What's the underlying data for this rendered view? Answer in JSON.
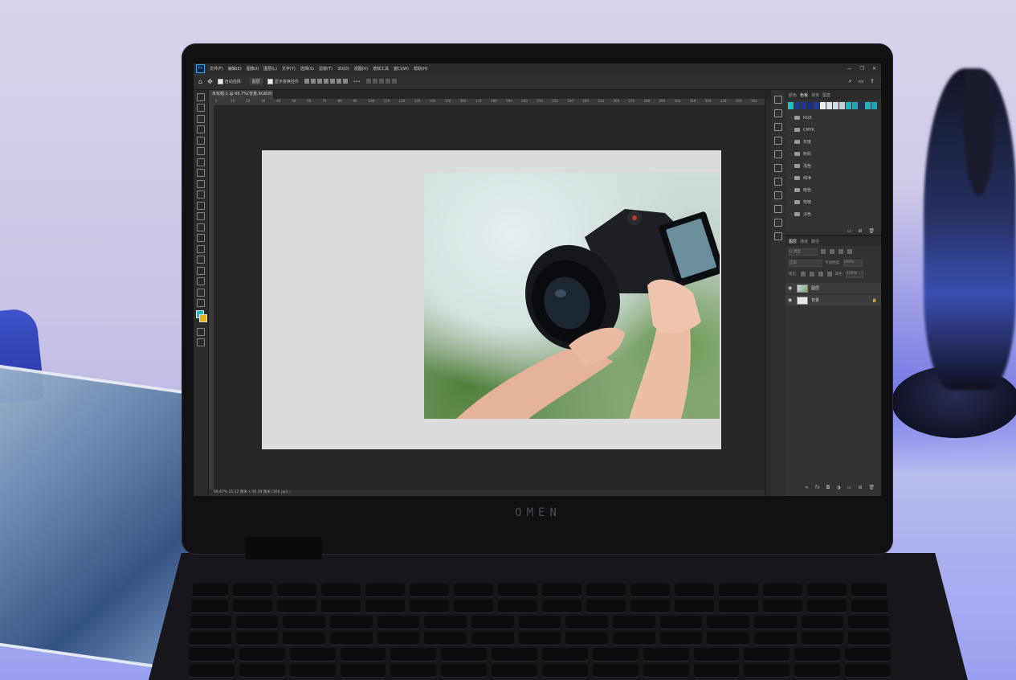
{
  "device": {
    "brand": "OMEN"
  },
  "photoshop": {
    "menu": [
      "文件(F)",
      "编辑(E)",
      "图像(I)",
      "图层(L)",
      "文字(Y)",
      "选择(S)",
      "滤镜(T)",
      "3D(D)",
      "视图(V)",
      "增效工具",
      "窗口(W)",
      "帮助(H)"
    ],
    "window_controls": [
      "—",
      "❐",
      "✕"
    ],
    "options_bar": {
      "auto_select_label": "自动选择：",
      "layer_select": "图层",
      "show_transform_label": "显示变换控件",
      "more": "•••"
    },
    "document_tab": "未标题-1 @ 66.7%(背景,RGB/8)",
    "ruler_ticks": [
      "0",
      "10",
      "20",
      "30",
      "40",
      "50",
      "60",
      "70",
      "80",
      "90",
      "100",
      "110",
      "120",
      "130",
      "140",
      "150",
      "160",
      "170",
      "180",
      "190",
      "200",
      "210",
      "220",
      "230",
      "240",
      "250",
      "260",
      "270",
      "280",
      "290",
      "300",
      "310",
      "320",
      "330",
      "340",
      "350"
    ],
    "status_bar": "66.67%   25.12 厘米 x 40.39 厘米 (300 ppi)   ›",
    "swatches_panel": {
      "tabs": [
        "颜色",
        "色板",
        "渐变",
        "图案"
      ],
      "active_tab": "色板",
      "swatch_colors": [
        "#1ec3c7",
        "#1b3b8f",
        "#21338c",
        "#15308a",
        "#1d3a99",
        "#e9eef2",
        "#dfe5ea",
        "#d1dbe3",
        "#c6d1dc",
        "#1fb8c5",
        "#19a7b8",
        "#222f5e",
        "#1cb5c4",
        "#14a9bd"
      ],
      "folders": [
        "RGB",
        "CMYK",
        "灰度",
        "粉彩",
        "浅色",
        "纯净",
        "暗色",
        "较暗",
        "淡色"
      ]
    },
    "layers_panel": {
      "tabs": [
        "图层",
        "通道",
        "路径"
      ],
      "active_tab": "图层",
      "kind_filter": "Q 类型",
      "blend_mode": "正常",
      "opacity_label": "不透明度:",
      "opacity_value": "100%",
      "lock_label": "锁定:",
      "fill_label": "填充:",
      "fill_value": "100%",
      "layers": [
        {
          "name": "图层",
          "has_image": true
        },
        {
          "name": "背景",
          "has_image": false
        }
      ]
    }
  }
}
